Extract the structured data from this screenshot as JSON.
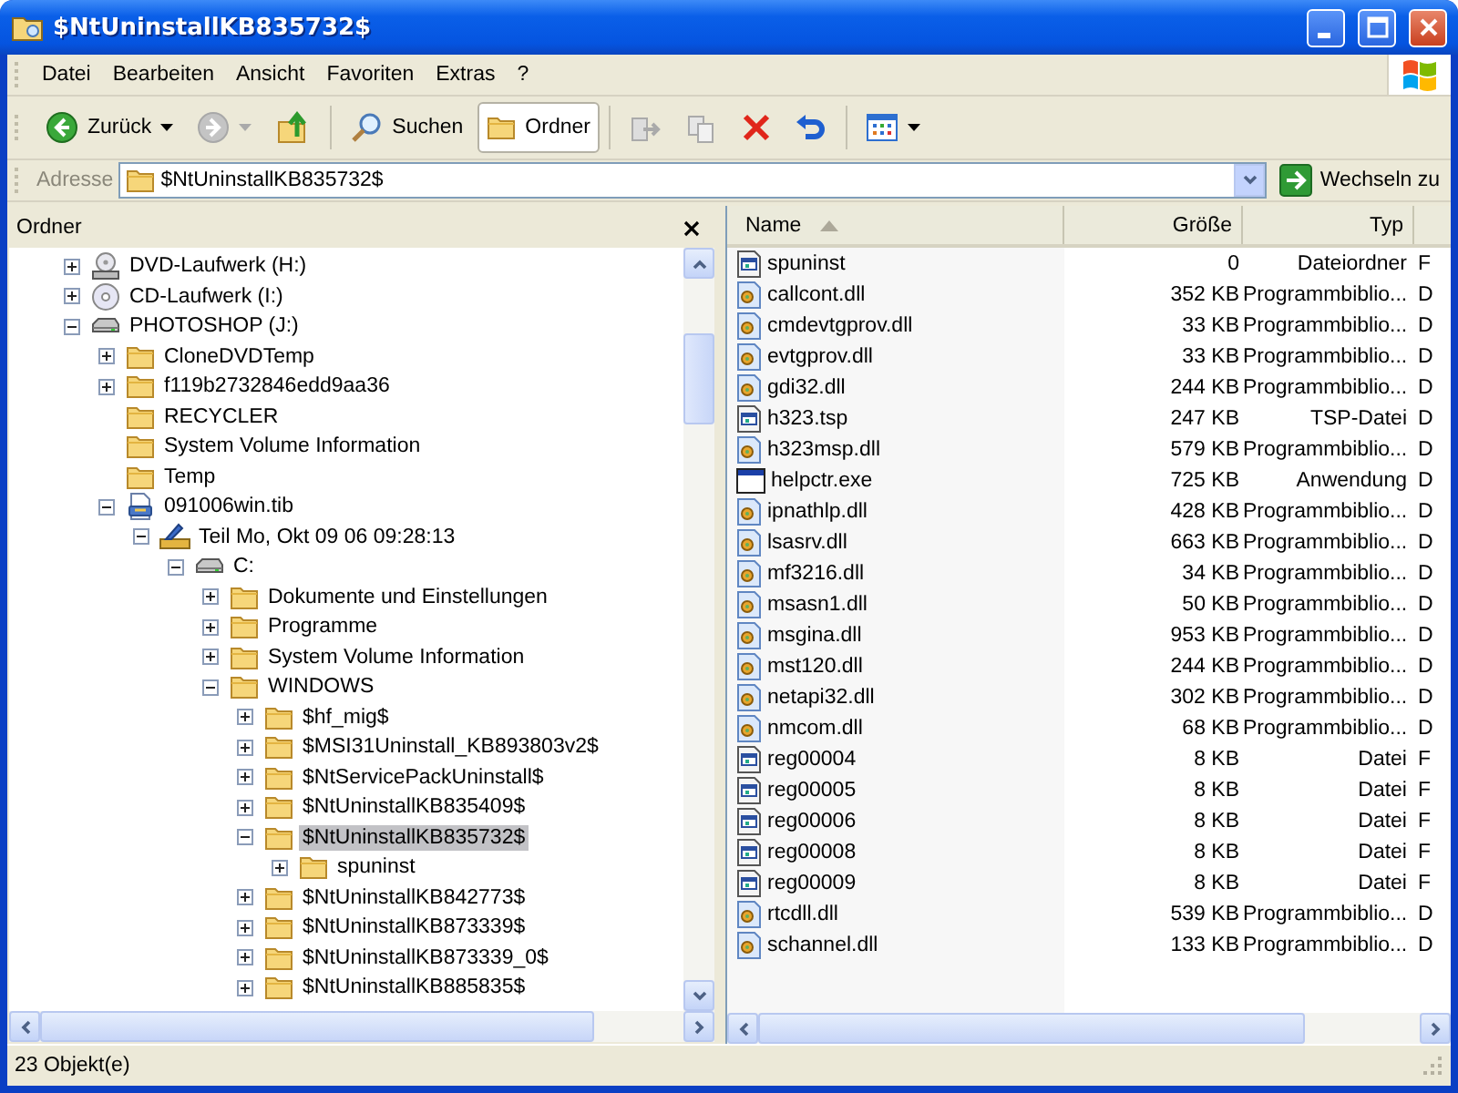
{
  "window": {
    "title": "$NtUninstallKB835732$"
  },
  "menu": [
    "Datei",
    "Bearbeiten",
    "Ansicht",
    "Favoriten",
    "Extras",
    "?"
  ],
  "toolbar": [
    {
      "kind": "back",
      "label": "Zurück",
      "disabled": false,
      "pressed": false,
      "dropdown": true
    },
    {
      "kind": "forward",
      "disabled": true,
      "pressed": false,
      "dropdown": true
    },
    {
      "kind": "up",
      "disabled": false,
      "pressed": false,
      "dropdown": false
    },
    {
      "kind": "separator"
    },
    {
      "kind": "search",
      "label": "Suchen",
      "disabled": false,
      "pressed": false,
      "dropdown": false
    },
    {
      "kind": "folders",
      "label": "Ordner",
      "disabled": false,
      "pressed": true,
      "dropdown": false
    },
    {
      "kind": "separator"
    },
    {
      "kind": "move",
      "disabled": true,
      "pressed": false,
      "dropdown": false
    },
    {
      "kind": "copy",
      "disabled": true,
      "pressed": false,
      "dropdown": false
    },
    {
      "kind": "delete",
      "disabled": false,
      "pressed": false,
      "dropdown": false
    },
    {
      "kind": "undo",
      "disabled": false,
      "pressed": false,
      "dropdown": false
    },
    {
      "kind": "separator"
    },
    {
      "kind": "views",
      "disabled": false,
      "pressed": false,
      "dropdown": true
    }
  ],
  "address": {
    "label": "Adresse",
    "value": "$NtUninstallKB835732$",
    "go_label": "Wechseln zu"
  },
  "folders_pane": {
    "title": "Ordner",
    "tree": [
      {
        "label": "DVD-Laufwerk (H:)",
        "kind": "dvd-drive",
        "expanded": false,
        "selected": false
      },
      {
        "label": "CD-Laufwerk (I:)",
        "kind": "cd-drive",
        "expanded": false,
        "selected": false
      },
      {
        "label": "PHOTOSHOP (J:)",
        "kind": "drive",
        "expanded": true,
        "selected": false,
        "children": [
          {
            "label": "CloneDVDTemp",
            "kind": "folder",
            "expanded": false,
            "selected": false
          },
          {
            "label": "f119b2732846edd9aa36",
            "kind": "folder",
            "expanded": false,
            "selected": false
          },
          {
            "label": "RECYCLER",
            "kind": "folder",
            "selected": false
          },
          {
            "label": "System Volume Information",
            "kind": "folder",
            "selected": false
          },
          {
            "label": "Temp",
            "kind": "folder",
            "selected": false
          },
          {
            "label": "091006win.tib",
            "kind": "archive",
            "expanded": true,
            "selected": false,
            "children": [
              {
                "label": "Teil Mo, Okt 09 06 09:28:13",
                "kind": "part",
                "expanded": true,
                "selected": false,
                "children": [
                  {
                    "label": "C:",
                    "kind": "drive",
                    "expanded": true,
                    "selected": false,
                    "children": [
                      {
                        "label": "Dokumente und Einstellungen",
                        "kind": "folder",
                        "expanded": false,
                        "selected": false
                      },
                      {
                        "label": "Programme",
                        "kind": "folder",
                        "expanded": false,
                        "selected": false
                      },
                      {
                        "label": "System Volume Information",
                        "kind": "folder",
                        "expanded": false,
                        "selected": false
                      },
                      {
                        "label": "WINDOWS",
                        "kind": "folder",
                        "expanded": true,
                        "selected": false,
                        "children": [
                          {
                            "label": "$hf_mig$",
                            "kind": "folder",
                            "expanded": false,
                            "selected": false
                          },
                          {
                            "label": "$MSI31Uninstall_KB893803v2$",
                            "kind": "folder",
                            "expanded": false,
                            "selected": false
                          },
                          {
                            "label": "$NtServicePackUninstall$",
                            "kind": "folder",
                            "expanded": false,
                            "selected": false
                          },
                          {
                            "label": "$NtUninstallKB835409$",
                            "kind": "folder",
                            "expanded": false,
                            "selected": false
                          },
                          {
                            "label": "$NtUninstallKB835732$",
                            "kind": "folder",
                            "expanded": true,
                            "selected": true,
                            "children": [
                              {
                                "label": "spuninst",
                                "kind": "folder",
                                "expanded": false,
                                "selected": false
                              }
                            ]
                          },
                          {
                            "label": "$NtUninstallKB842773$",
                            "kind": "folder",
                            "expanded": false,
                            "selected": false
                          },
                          {
                            "label": "$NtUninstallKB873339$",
                            "kind": "folder",
                            "expanded": false,
                            "selected": false
                          },
                          {
                            "label": "$NtUninstallKB873339_0$",
                            "kind": "folder",
                            "expanded": false,
                            "selected": false
                          },
                          {
                            "label": "$NtUninstallKB885835$",
                            "kind": "folder",
                            "expanded": false,
                            "selected": false
                          }
                        ]
                      }
                    ]
                  }
                ]
              }
            ]
          }
        ]
      }
    ]
  },
  "file_list": {
    "columns": [
      {
        "label": "Name",
        "sorted": true
      },
      {
        "label": "Größe",
        "sorted": false
      },
      {
        "label": "Typ",
        "sorted": false
      }
    ],
    "rows": [
      {
        "kind": "file",
        "name": "spuninst",
        "size": "0",
        "type": "Dateiordner",
        "column_4": "F"
      },
      {
        "kind": "dll",
        "name": "callcont.dll",
        "size": "352 KB",
        "type": "Programmbiblio...",
        "column_4": "D"
      },
      {
        "kind": "dll",
        "name": "cmdevtgprov.dll",
        "size": "33 KB",
        "type": "Programmbiblio...",
        "column_4": "D"
      },
      {
        "kind": "dll",
        "name": "evtgprov.dll",
        "size": "33 KB",
        "type": "Programmbiblio...",
        "column_4": "D"
      },
      {
        "kind": "dll",
        "name": "gdi32.dll",
        "size": "244 KB",
        "type": "Programmbiblio...",
        "column_4": "D"
      },
      {
        "kind": "file",
        "name": "h323.tsp",
        "size": "247 KB",
        "type": "TSP-Datei",
        "column_4": "D"
      },
      {
        "kind": "dll",
        "name": "h323msp.dll",
        "size": "579 KB",
        "type": "Programmbiblio...",
        "column_4": "D"
      },
      {
        "kind": "exe",
        "name": "helpctr.exe",
        "size": "725 KB",
        "type": "Anwendung",
        "column_4": "D"
      },
      {
        "kind": "dll",
        "name": "ipnathlp.dll",
        "size": "428 KB",
        "type": "Programmbiblio...",
        "column_4": "D"
      },
      {
        "kind": "dll",
        "name": "lsasrv.dll",
        "size": "663 KB",
        "type": "Programmbiblio...",
        "column_4": "D"
      },
      {
        "kind": "dll",
        "name": "mf3216.dll",
        "size": "34 KB",
        "type": "Programmbiblio...",
        "column_4": "D"
      },
      {
        "kind": "dll",
        "name": "msasn1.dll",
        "size": "50 KB",
        "type": "Programmbiblio...",
        "column_4": "D"
      },
      {
        "kind": "dll",
        "name": "msgina.dll",
        "size": "953 KB",
        "type": "Programmbiblio...",
        "column_4": "D"
      },
      {
        "kind": "dll",
        "name": "mst120.dll",
        "size": "244 KB",
        "type": "Programmbiblio...",
        "column_4": "D"
      },
      {
        "kind": "dll",
        "name": "netapi32.dll",
        "size": "302 KB",
        "type": "Programmbiblio...",
        "column_4": "D"
      },
      {
        "kind": "dll",
        "name": "nmcom.dll",
        "size": "68 KB",
        "type": "Programmbiblio...",
        "column_4": "D"
      },
      {
        "kind": "file",
        "name": "reg00004",
        "size": "8 KB",
        "type": "Datei",
        "column_4": "F"
      },
      {
        "kind": "file",
        "name": "reg00005",
        "size": "8 KB",
        "type": "Datei",
        "column_4": "F"
      },
      {
        "kind": "file",
        "name": "reg00006",
        "size": "8 KB",
        "type": "Datei",
        "column_4": "F"
      },
      {
        "kind": "file",
        "name": "reg00008",
        "size": "8 KB",
        "type": "Datei",
        "column_4": "F"
      },
      {
        "kind": "file",
        "name": "reg00009",
        "size": "8 KB",
        "type": "Datei",
        "column_4": "F"
      },
      {
        "kind": "dll",
        "name": "rtcdll.dll",
        "size": "539 KB",
        "type": "Programmbiblio...",
        "column_4": "D"
      },
      {
        "kind": "dll",
        "name": "schannel.dll",
        "size": "133 KB",
        "type": "Programmbiblio...",
        "column_4": "D"
      }
    ]
  },
  "status_bar": {
    "text": "23 Objekt(e)"
  }
}
